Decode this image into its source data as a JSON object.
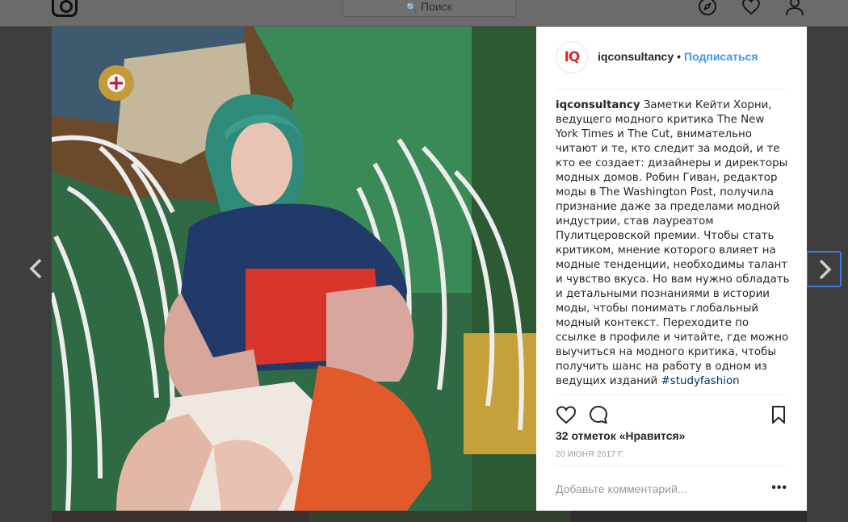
{
  "app": {
    "search_placeholder": "Поиск",
    "header_icons": [
      "instagram-logo-icon",
      "explore-compass-icon",
      "heart-icon",
      "profile-icon"
    ]
  },
  "post": {
    "avatar_text": "IQ",
    "username": "iqconsultancy",
    "separator": "•",
    "follow_label": "Подписаться",
    "caption_user": "iqconsultancy",
    "caption_text": "Заметки Кейти Хорни, ведущего модного критика The New York Times и The Cut, внимательно читают и те, кто следит за модой, и те кто ее создает: дизайнеры и директоры модных домов. Робин Гиван, редактор моды в The Washington Post, получила признание даже за пределами модной индустрии, став лауреатом Пулитцеровской премии. Чтобы стать критиком, мнение которого влияет на модные тенденции, необходимы талант и чувство вкуса. Но вам нужно обладать и детальными познаниями в истории моды, чтобы понимать глобальный модный контекст. Переходите по ссылке в профиле и читайте, где можно выучиться на модного критика, чтобы получить шанс на работу в одном из ведущих изданий",
    "hashtag": "#studyfashion",
    "likes": "32 отметок «Нравится»",
    "date": "20 ИЮНЯ 2017 Г.",
    "comment_placeholder": "Добавьте комментарий...",
    "more_label": "•••"
  },
  "colors": {
    "accent": "#3897f0",
    "hashtag": "#003569",
    "avatar_text": "#d52b2b"
  }
}
